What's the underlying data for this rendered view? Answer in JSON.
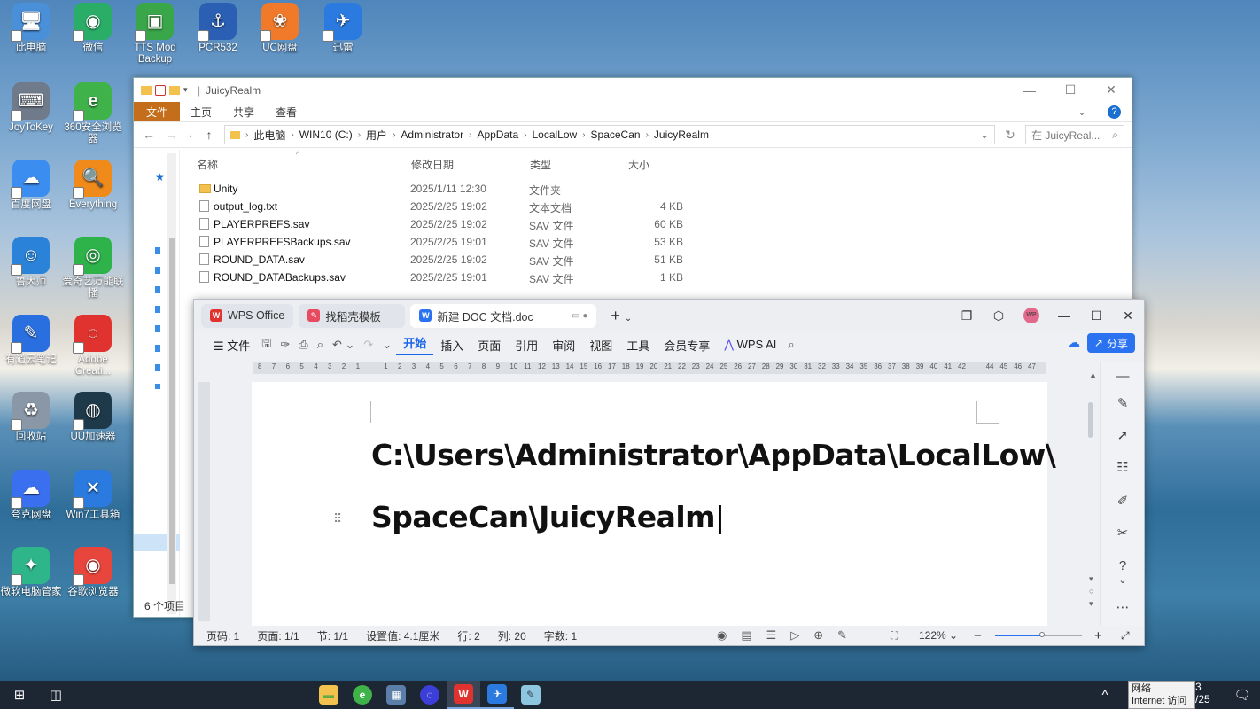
{
  "desktop": {
    "icons": [
      {
        "label": "此电脑",
        "color": "#4a90d9",
        "glyph": "🖥"
      },
      {
        "label": "微信",
        "color": "#2aae67",
        "glyph": "◉"
      },
      {
        "label": "TTS Mod Backup",
        "color": "#3aa64a",
        "glyph": "▣"
      },
      {
        "label": "PCR532",
        "color": "#2b5fb3",
        "glyph": "⚓"
      },
      {
        "label": "UC网盘",
        "color": "#f07a2a",
        "glyph": "❀"
      },
      {
        "label": "迅雷",
        "color": "#2a7ae0",
        "glyph": "✈"
      },
      {
        "label": "JoyToKey",
        "color": "#6f7b8a",
        "glyph": "⌨"
      },
      {
        "label": "360安全浏览器",
        "color": "#3fb34a",
        "glyph": "e"
      },
      {
        "label": "百度网盘",
        "color": "#3b8ef0",
        "glyph": "☁"
      },
      {
        "label": "Everything",
        "color": "#f08a1a",
        "glyph": "🔍"
      },
      {
        "label": "鲁大师",
        "color": "#2a83d8",
        "glyph": "☺"
      },
      {
        "label": "爱奇艺万能联播",
        "color": "#2db34a",
        "glyph": "◎"
      },
      {
        "label": "有道云笔记",
        "color": "#2a6fe0",
        "glyph": "✎"
      },
      {
        "label": "Adobe Creati...",
        "color": "#e0332f",
        "glyph": "◌"
      },
      {
        "label": "回收站",
        "color": "#8a97a6",
        "glyph": "♻"
      },
      {
        "label": "UU加速器",
        "color": "#1e3a4a",
        "glyph": "◍"
      },
      {
        "label": "夸克网盘",
        "color": "#3a6ff0",
        "glyph": "☁"
      },
      {
        "label": "Win7工具箱",
        "color": "#2a7ae0",
        "glyph": "✕"
      },
      {
        "label": "微软电脑管家",
        "color": "#2fb58a",
        "glyph": "✦"
      },
      {
        "label": "谷歌浏览器",
        "color": "#e8453c",
        "glyph": "◉"
      }
    ]
  },
  "explorer": {
    "title": "JuicyRealm",
    "ribbon": {
      "file": "文件",
      "home": "主页",
      "share": "共享",
      "view": "查看"
    },
    "breadcrumb": [
      "此电脑",
      "WIN10 (C:)",
      "用户",
      "Administrator",
      "AppData",
      "LocalLow",
      "SpaceCan",
      "JuicyRealm"
    ],
    "search_placeholder": "在 JuicyReal...",
    "columns": {
      "name": "名称",
      "date": "修改日期",
      "type": "类型",
      "size": "大小"
    },
    "files": [
      {
        "name": "Unity",
        "date": "2025/1/11 12:30",
        "type": "文件夹",
        "size": "",
        "folder": true
      },
      {
        "name": "output_log.txt",
        "date": "2025/2/25 19:02",
        "type": "文本文档",
        "size": "4 KB",
        "folder": false
      },
      {
        "name": "PLAYERPREFS.sav",
        "date": "2025/2/25 19:02",
        "type": "SAV 文件",
        "size": "60 KB",
        "folder": false
      },
      {
        "name": "PLAYERPREFSBackups.sav",
        "date": "2025/2/25 19:01",
        "type": "SAV 文件",
        "size": "53 KB",
        "folder": false
      },
      {
        "name": "ROUND_DATA.sav",
        "date": "2025/2/25 19:02",
        "type": "SAV 文件",
        "size": "51 KB",
        "folder": false
      },
      {
        "name": "ROUND_DATABackups.sav",
        "date": "2025/2/25 19:01",
        "type": "SAV 文件",
        "size": "1 KB",
        "folder": false
      }
    ],
    "status": "6 个项目"
  },
  "wps": {
    "tabs": {
      "home": "WPS Office",
      "templates": "找稻壳模板",
      "doc": "新建 DOC 文档.doc"
    },
    "avatar": "WP",
    "menu": {
      "file": "文件",
      "start": "开始",
      "insert": "插入",
      "page": "页面",
      "reference": "引用",
      "review": "审阅",
      "view": "视图",
      "tools": "工具",
      "member": "会员专享",
      "ai": "WPS AI"
    },
    "share": "分享",
    "doc_lines": [
      "C:\\Users\\Administrator\\AppData\\LocalLow\\",
      "SpaceCan\\JuicyRealm"
    ],
    "status": {
      "page_no": "页码: 1",
      "pages": "页面: 1/1",
      "section": "节: 1/1",
      "setting": "设置值: 4.1厘米",
      "row": "行: 2",
      "col": "列: 20",
      "words": "字数: 1",
      "zoom": "122%"
    }
  },
  "taskbar": {
    "tooltip_line1": "网络",
    "tooltip_line2": "Internet 访问",
    "clock_fragment": "3",
    "date_fragment": "/25"
  }
}
